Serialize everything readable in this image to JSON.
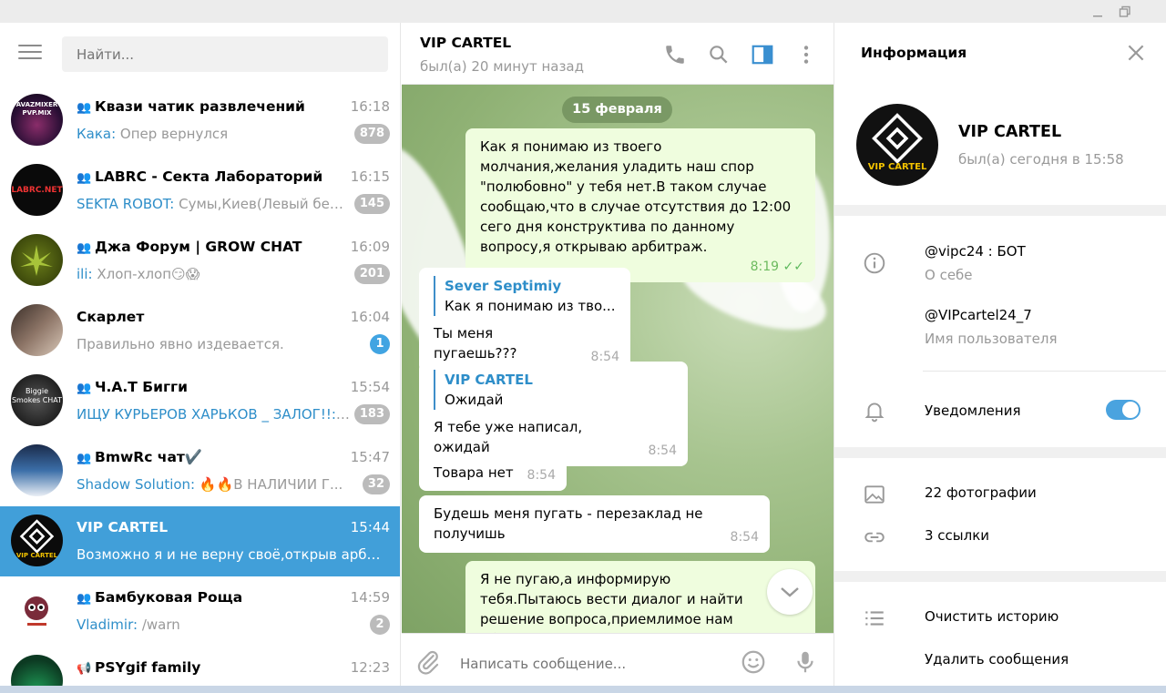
{
  "window": {
    "minimize_icon": "minimize-icon",
    "restore_icon": "restore-icon"
  },
  "sidebar": {
    "search_placeholder": "Найти...",
    "chats": [
      {
        "name": "Квази чатик развлечений",
        "group": true,
        "time": "16:18",
        "sender": "Кака:",
        "preview": " Опер вернулся",
        "badge": "878",
        "badge_color": "#bbbbbb"
      },
      {
        "name": "LABRC - Секта Лабораторий",
        "group": true,
        "time": "16:15",
        "sender": "SEKTA ROBOT:",
        "preview": " Сумы,Киев(Левый бер...",
        "badge": "145",
        "badge_color": "#bbbbbb"
      },
      {
        "name": "Джа Форум | GROW CHAT",
        "group": true,
        "time": "16:09",
        "sender": "ili:",
        "preview": " Хлоп-хлоп😏😱",
        "badge": "201",
        "badge_color": "#bbbbbb"
      },
      {
        "name": "Скарлет",
        "group": false,
        "time": "16:04",
        "sender": "",
        "preview": "Правильно явно издевается.",
        "badge": "1",
        "badge_color": "#41a4e2"
      },
      {
        "name": "Ч.А.Т Бигги",
        "group": true,
        "time": "15:54",
        "sender": "ИЩУ КУРЬЕРОВ ХАРЬКОВ _ ЗАЛОГ!!: ...",
        "preview": "",
        "badge": "183",
        "badge_color": "#bbbbbb"
      },
      {
        "name": "BmwRc чат✔️",
        "group": true,
        "time": "15:47",
        "sender": "Shadow Solution:",
        "preview": " 🔥🔥В НАЛИЧИИ Г...",
        "badge": "32",
        "badge_color": "#bbbbbb"
      },
      {
        "name": "VIP CARTEL",
        "group": false,
        "time": "15:44",
        "sender": "",
        "preview": "Возможно я и не верну своё,открыв арбит...",
        "badge": "",
        "badge_color": ""
      },
      {
        "name": "Бамбуковая Роща",
        "group": true,
        "time": "14:59",
        "sender": "Vladimir:",
        "preview": " /warn",
        "badge": "2",
        "badge_color": "#bbbbbb"
      },
      {
        "name": "PSYgif family",
        "group": true,
        "time": "12:23",
        "sender": "",
        "preview": "",
        "badge": "",
        "badge_color": ""
      }
    ],
    "avatar_texts": [
      "AVAZMIXER PVP.MIX",
      "LABRC.NET",
      "",
      "",
      "Biggie Smokes CHAT",
      "",
      "VIP CARTEL",
      "",
      ""
    ]
  },
  "chat": {
    "title": "VIP CARTEL",
    "status": "был(а) 20 минут назад",
    "date": "15 февраля",
    "messages": {
      "m1": {
        "text": "Как я понимаю из твоего молчания,желания уладить наш спор \"полюбовно\"  у тебя нет.В таком случае сообщаю,что в случае отсутствия до 12:00 сего дня конструктива по данному вопросу,я открываю арбитраж.",
        "time": "8:19"
      },
      "m2": {
        "reply_name": "Sever Septimiy",
        "reply_text": "Как я понимаю из тво...",
        "text": "Ты меня пугаешь???",
        "time": "8:54"
      },
      "m3": {
        "reply_name": "VIP CARTEL",
        "reply_text": "Ожидай",
        "text": "Я тебе уже написал, ожидай",
        "time": "8:54"
      },
      "m4": {
        "text": "Товара нет",
        "time": "8:54"
      },
      "m5": {
        "text": "Будешь меня пугать - перезаклад не получишь",
        "time": "8:54"
      },
      "m6": {
        "text": "Я не пугаю,а информирую тебя.Пытаюсь вести диалог и найти решение вопроса,приемлимое нам обоим.Нельзя"
      }
    },
    "input_placeholder": "Написать сообщение..."
  },
  "info": {
    "title": "Информация",
    "name": "VIP CARTEL",
    "status": "был(а) сегодня в 15:58",
    "avatar_text": "VIP CARTEL",
    "about_value": "@vipc24 : БОТ",
    "about_label": "О себе",
    "username_value": "@VIPcartel24_7",
    "username_label": "Имя пользователя",
    "notifications_label": "Уведомления",
    "notifications_on": true,
    "photos": "22 фотографии",
    "links": "3 ссылки",
    "clear_history": "Очистить историю",
    "delete_messages": "Удалить сообщения"
  },
  "colors": {
    "accent": "#419fd9",
    "outgoing_bubble": "#effdde",
    "sender_name": "#2e8ec9",
    "toggle": "#4aa3df"
  }
}
